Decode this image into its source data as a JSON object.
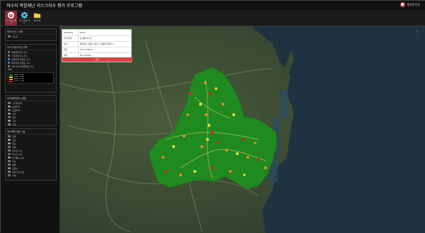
{
  "window": {
    "title": "저수지 복합재난 리스크지수 평가 프로그램",
    "logo_label": "행정안전부"
  },
  "toolbar": [
    {
      "label": "리스크지수 평가",
      "icon": "reservoir-icon"
    },
    {
      "label": "리스크지수 계산",
      "icon": "gear-icon"
    },
    {
      "label": "결과저장",
      "icon": "folder-icon"
    }
  ],
  "panels": {
    "layer": {
      "title": "레이어 표시 여부",
      "items": [
        {
          "label": "저수지",
          "color": "#d22"
        }
      ]
    },
    "index": {
      "title": "리스크 평가지수 선택",
      "options": [
        {
          "label": "재해위험지수 지수",
          "checked": false
        },
        {
          "label": "기후위험지수 지수",
          "checked": false
        },
        {
          "label": "인명피해 위험도 지수",
          "checked": true
        },
        {
          "label": "재산피해 위험도 지수",
          "checked": false
        },
        {
          "label": "기반시설 피해위험도 지수",
          "checked": false
        }
      ],
      "legend_title": "범례",
      "legend": [
        {
          "label": "0.00 - 0.24",
          "color": "#1a9a1a"
        },
        {
          "label": "0.24 - 0.50",
          "color": "#e8e03a"
        },
        {
          "label": "0.50 - 0.74",
          "color": "#f08a2a"
        },
        {
          "label": "0.74 - 1.00",
          "color": "#d22"
        }
      ]
    },
    "landcover": {
      "title": "토지피복(용도) 현황",
      "items": [
        {
          "label": "시가화지역",
          "color": "#e05050"
        },
        {
          "label": "농업지역",
          "color": "#f2e24a"
        },
        {
          "label": "산림지역",
          "color": "#2a8a2a"
        },
        {
          "label": "초지",
          "color": "#9ad070"
        },
        {
          "label": "습지",
          "color": "#6a4aa0"
        },
        {
          "label": "나지",
          "color": "#cde"
        },
        {
          "label": "수역",
          "color": "#3a7ad0"
        }
      ]
    },
    "facility": {
      "title": "재산피해 대상 시설",
      "items": [
        {
          "label": "건물",
          "color": "#2a8a2a"
        },
        {
          "label": "도로",
          "color": "#fff"
        },
        {
          "label": "철도",
          "color": "#ddd"
        },
        {
          "label": "교량",
          "color": "#e05050"
        },
        {
          "label": "상수도시설",
          "color": "#7a4aa0"
        },
        {
          "label": "하수도시설",
          "color": "#333"
        },
        {
          "label": "전기통신시설",
          "color": "#f2e24a"
        },
        {
          "label": "학교",
          "color": "#3a7ad0"
        },
        {
          "label": "병원",
          "color": "#e33"
        },
        {
          "label": "관공서",
          "color": "#aaa"
        },
        {
          "label": "농업기반시설",
          "color": "#5ab05a"
        },
        {
          "label": "기타",
          "color": "#333"
        }
      ]
    }
  },
  "popup": {
    "header_key": "Attribute",
    "header_value": "Value",
    "rows": [
      {
        "key": "저수지명",
        "value": "신이동저수지"
      },
      {
        "key": "주소",
        "value": "경상북도 포항시 북구 흥해읍 학천리 1"
      },
      {
        "key": "위도",
        "value": "129.333616"
      },
      {
        "key": "경도",
        "value": "36.123415"
      }
    ],
    "close_label": "닫기"
  },
  "map": {
    "zoom_in": "+",
    "zoom_out": "−"
  },
  "colors": {
    "region_fill": "#1f8a1f",
    "risk_low": "#1a9a1a",
    "risk_mid": "#e8e03a",
    "risk_high": "#f08a2a",
    "risk_top": "#d22"
  }
}
